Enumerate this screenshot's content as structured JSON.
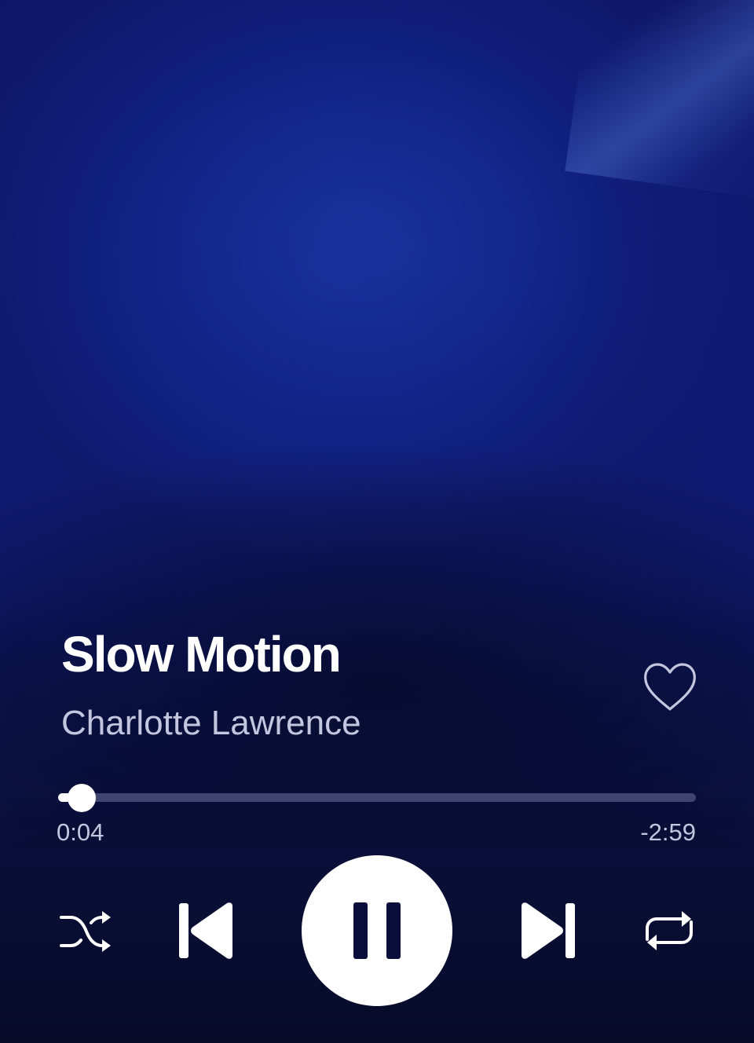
{
  "track": {
    "title": "Slow Motion",
    "artist": "Charlotte Lawrence",
    "liked": false
  },
  "playback": {
    "elapsed": "0:04",
    "remaining": "-2:59",
    "progress_fraction": 0.037,
    "state": "playing"
  },
  "controls": {
    "shuffle_icon": "shuffle-icon",
    "previous_icon": "skip-back-icon",
    "pause_icon": "pause-icon",
    "next_icon": "skip-forward-icon",
    "repeat_icon": "repeat-icon",
    "like_icon": "heart-outline-icon"
  },
  "colors": {
    "background_top": "#112180",
    "background_bottom": "#070b28",
    "text_primary": "#ffffff",
    "text_secondary": "#c3c6de",
    "progress_track": "#3f4470"
  }
}
